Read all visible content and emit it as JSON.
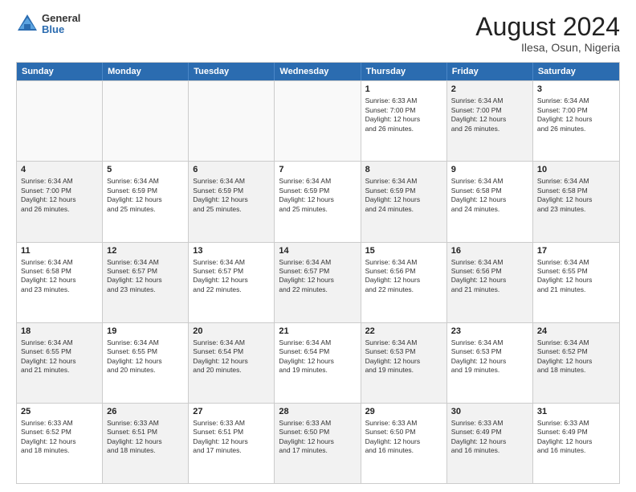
{
  "header": {
    "logo": {
      "general": "General",
      "blue": "Blue"
    },
    "title": "August 2024",
    "location": "Ilesa, Osun, Nigeria"
  },
  "weekdays": [
    "Sunday",
    "Monday",
    "Tuesday",
    "Wednesday",
    "Thursday",
    "Friday",
    "Saturday"
  ],
  "rows": [
    [
      {
        "day": "",
        "info": "",
        "shaded": false,
        "empty": true
      },
      {
        "day": "",
        "info": "",
        "shaded": false,
        "empty": true
      },
      {
        "day": "",
        "info": "",
        "shaded": false,
        "empty": true
      },
      {
        "day": "",
        "info": "",
        "shaded": false,
        "empty": true
      },
      {
        "day": "1",
        "info": "Sunrise: 6:33 AM\nSunset: 7:00 PM\nDaylight: 12 hours\nand 26 minutes.",
        "shaded": false,
        "empty": false
      },
      {
        "day": "2",
        "info": "Sunrise: 6:34 AM\nSunset: 7:00 PM\nDaylight: 12 hours\nand 26 minutes.",
        "shaded": true,
        "empty": false
      },
      {
        "day": "3",
        "info": "Sunrise: 6:34 AM\nSunset: 7:00 PM\nDaylight: 12 hours\nand 26 minutes.",
        "shaded": false,
        "empty": false
      }
    ],
    [
      {
        "day": "4",
        "info": "Sunrise: 6:34 AM\nSunset: 7:00 PM\nDaylight: 12 hours\nand 26 minutes.",
        "shaded": true,
        "empty": false
      },
      {
        "day": "5",
        "info": "Sunrise: 6:34 AM\nSunset: 6:59 PM\nDaylight: 12 hours\nand 25 minutes.",
        "shaded": false,
        "empty": false
      },
      {
        "day": "6",
        "info": "Sunrise: 6:34 AM\nSunset: 6:59 PM\nDaylight: 12 hours\nand 25 minutes.",
        "shaded": true,
        "empty": false
      },
      {
        "day": "7",
        "info": "Sunrise: 6:34 AM\nSunset: 6:59 PM\nDaylight: 12 hours\nand 25 minutes.",
        "shaded": false,
        "empty": false
      },
      {
        "day": "8",
        "info": "Sunrise: 6:34 AM\nSunset: 6:59 PM\nDaylight: 12 hours\nand 24 minutes.",
        "shaded": true,
        "empty": false
      },
      {
        "day": "9",
        "info": "Sunrise: 6:34 AM\nSunset: 6:58 PM\nDaylight: 12 hours\nand 24 minutes.",
        "shaded": false,
        "empty": false
      },
      {
        "day": "10",
        "info": "Sunrise: 6:34 AM\nSunset: 6:58 PM\nDaylight: 12 hours\nand 23 minutes.",
        "shaded": true,
        "empty": false
      }
    ],
    [
      {
        "day": "11",
        "info": "Sunrise: 6:34 AM\nSunset: 6:58 PM\nDaylight: 12 hours\nand 23 minutes.",
        "shaded": false,
        "empty": false
      },
      {
        "day": "12",
        "info": "Sunrise: 6:34 AM\nSunset: 6:57 PM\nDaylight: 12 hours\nand 23 minutes.",
        "shaded": true,
        "empty": false
      },
      {
        "day": "13",
        "info": "Sunrise: 6:34 AM\nSunset: 6:57 PM\nDaylight: 12 hours\nand 22 minutes.",
        "shaded": false,
        "empty": false
      },
      {
        "day": "14",
        "info": "Sunrise: 6:34 AM\nSunset: 6:57 PM\nDaylight: 12 hours\nand 22 minutes.",
        "shaded": true,
        "empty": false
      },
      {
        "day": "15",
        "info": "Sunrise: 6:34 AM\nSunset: 6:56 PM\nDaylight: 12 hours\nand 22 minutes.",
        "shaded": false,
        "empty": false
      },
      {
        "day": "16",
        "info": "Sunrise: 6:34 AM\nSunset: 6:56 PM\nDaylight: 12 hours\nand 21 minutes.",
        "shaded": true,
        "empty": false
      },
      {
        "day": "17",
        "info": "Sunrise: 6:34 AM\nSunset: 6:55 PM\nDaylight: 12 hours\nand 21 minutes.",
        "shaded": false,
        "empty": false
      }
    ],
    [
      {
        "day": "18",
        "info": "Sunrise: 6:34 AM\nSunset: 6:55 PM\nDaylight: 12 hours\nand 21 minutes.",
        "shaded": true,
        "empty": false
      },
      {
        "day": "19",
        "info": "Sunrise: 6:34 AM\nSunset: 6:55 PM\nDaylight: 12 hours\nand 20 minutes.",
        "shaded": false,
        "empty": false
      },
      {
        "day": "20",
        "info": "Sunrise: 6:34 AM\nSunset: 6:54 PM\nDaylight: 12 hours\nand 20 minutes.",
        "shaded": true,
        "empty": false
      },
      {
        "day": "21",
        "info": "Sunrise: 6:34 AM\nSunset: 6:54 PM\nDaylight: 12 hours\nand 19 minutes.",
        "shaded": false,
        "empty": false
      },
      {
        "day": "22",
        "info": "Sunrise: 6:34 AM\nSunset: 6:53 PM\nDaylight: 12 hours\nand 19 minutes.",
        "shaded": true,
        "empty": false
      },
      {
        "day": "23",
        "info": "Sunrise: 6:34 AM\nSunset: 6:53 PM\nDaylight: 12 hours\nand 19 minutes.",
        "shaded": false,
        "empty": false
      },
      {
        "day": "24",
        "info": "Sunrise: 6:34 AM\nSunset: 6:52 PM\nDaylight: 12 hours\nand 18 minutes.",
        "shaded": true,
        "empty": false
      }
    ],
    [
      {
        "day": "25",
        "info": "Sunrise: 6:33 AM\nSunset: 6:52 PM\nDaylight: 12 hours\nand 18 minutes.",
        "shaded": false,
        "empty": false
      },
      {
        "day": "26",
        "info": "Sunrise: 6:33 AM\nSunset: 6:51 PM\nDaylight: 12 hours\nand 18 minutes.",
        "shaded": true,
        "empty": false
      },
      {
        "day": "27",
        "info": "Sunrise: 6:33 AM\nSunset: 6:51 PM\nDaylight: 12 hours\nand 17 minutes.",
        "shaded": false,
        "empty": false
      },
      {
        "day": "28",
        "info": "Sunrise: 6:33 AM\nSunset: 6:50 PM\nDaylight: 12 hours\nand 17 minutes.",
        "shaded": true,
        "empty": false
      },
      {
        "day": "29",
        "info": "Sunrise: 6:33 AM\nSunset: 6:50 PM\nDaylight: 12 hours\nand 16 minutes.",
        "shaded": false,
        "empty": false
      },
      {
        "day": "30",
        "info": "Sunrise: 6:33 AM\nSunset: 6:49 PM\nDaylight: 12 hours\nand 16 minutes.",
        "shaded": true,
        "empty": false
      },
      {
        "day": "31",
        "info": "Sunrise: 6:33 AM\nSunset: 6:49 PM\nDaylight: 12 hours\nand 16 minutes.",
        "shaded": false,
        "empty": false
      }
    ]
  ]
}
